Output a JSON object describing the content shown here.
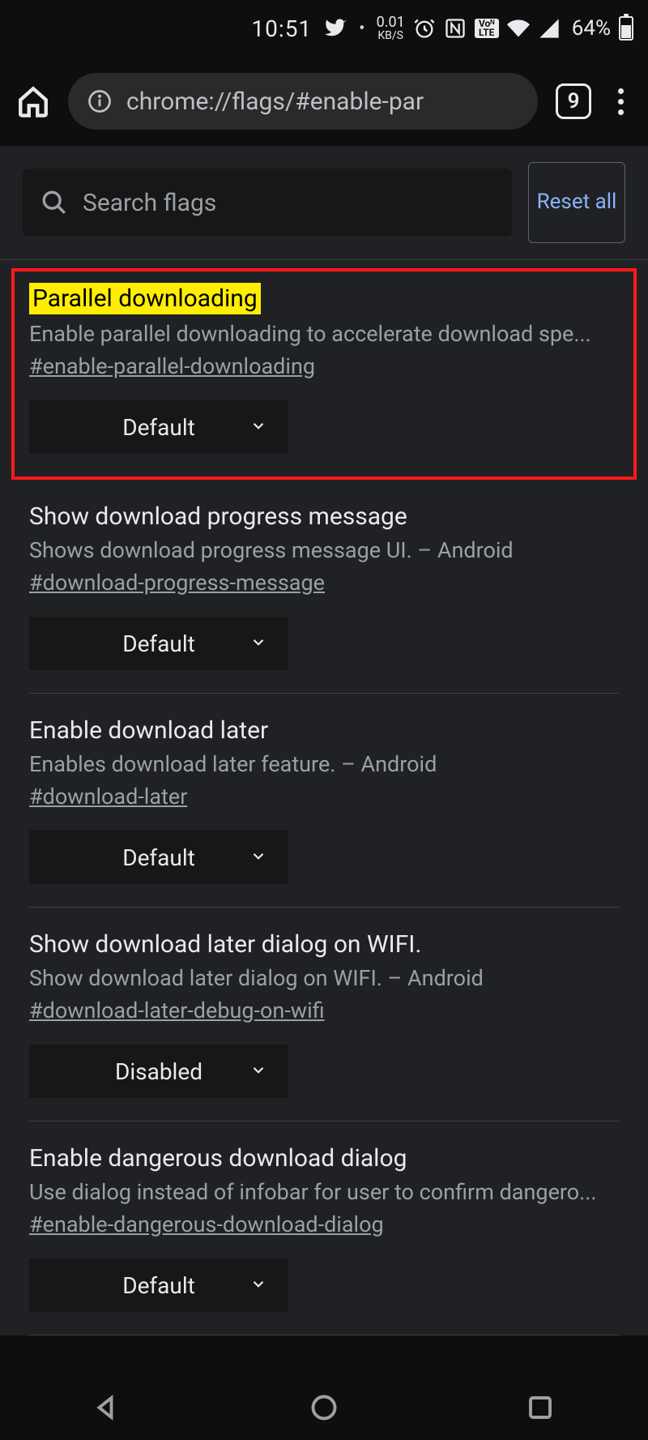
{
  "statusbar": {
    "time": "10:51",
    "net_speed_value": "0.01",
    "net_speed_unit": "KB/S",
    "volte_top": "Voᴺ",
    "volte_bot": "LTE",
    "battery_percent": "64%"
  },
  "addressbar": {
    "url": "chrome://flags/#enable-par",
    "tab_count": "9"
  },
  "search": {
    "placeholder": "Search flags",
    "reset_label": "Reset all"
  },
  "flags": [
    {
      "title": "Parallel downloading",
      "desc": "Enable parallel downloading to accelerate download spe...",
      "anchor": "#enable-parallel-downloading",
      "value": "Default",
      "highlight": true
    },
    {
      "title": "Show download progress message",
      "desc": "Shows download progress message UI. – Android",
      "anchor": "#download-progress-message",
      "value": "Default",
      "highlight": false
    },
    {
      "title": "Enable download later",
      "desc": "Enables download later feature. – Android",
      "anchor": "#download-later",
      "value": "Default",
      "highlight": false
    },
    {
      "title": "Show download later dialog on WIFI.",
      "desc": "Show download later dialog on WIFI. – Android",
      "anchor": "#download-later-debug-on-wifi",
      "value": "Disabled",
      "highlight": false
    },
    {
      "title": "Enable dangerous download dialog",
      "desc": "Use dialog instead of infobar for user to confirm dangero...",
      "anchor": "#enable-dangerous-download-dialog",
      "value": "Default",
      "highlight": false
    }
  ]
}
